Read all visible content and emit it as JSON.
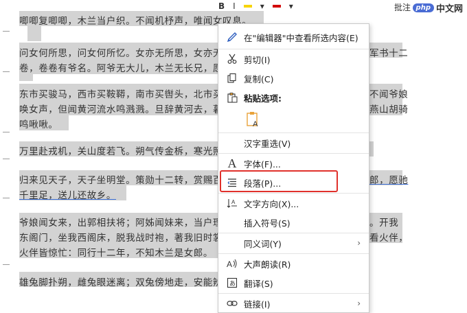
{
  "toolbar": {
    "comment_label": "批注"
  },
  "watermark": {
    "logo": "php",
    "text": "中文网"
  },
  "document": {
    "lines": [
      "唧唧复唧唧，木兰当户织。不闻机杼声，唯闻女叹息。",
      "问女何所思，问女何所忆。女亦无所思，女亦无",
      "卷，卷卷有爷名。阿爷无大儿，木兰无长兄，愿",
      "东市买骏马，西市买鞍鞯，南市买辔头，北市买",
      "唤女声，但闻黄河流水鸣溅溅。旦辞黄河去，暮",
      "鸣啾啾。",
      "万里赴戎机，关山度若飞。朔气传金柝，寒光照",
      "归来见天子，天子坐明堂。策勋十二转，赏赐百",
      "千里足，送儿还故乡。",
      "爷娘闻女来，出郭相扶将；阿姊闻妹来，当户理",
      "东阁门，坐我西阁床，脱我战时袍，著我旧时裳",
      "火伴皆惊忙：同行十二年，不知木兰是女郎。",
      "雄兔脚扑朔，雌兔眼迷离；双兔傍地走，安能辨"
    ],
    "right_fragments": [
      "军书十二",
      "不闻爷娘",
      "燕山胡骑",
      "郎，愿驰",
      "。开我",
      "看火伴，"
    ]
  },
  "context_menu": {
    "items": [
      {
        "label": "在\"编辑器\"中查看所选内容(E)",
        "icon": "pen-icon"
      },
      {
        "label": "剪切(I)",
        "icon": "scissors-icon"
      },
      {
        "label": "复制(C)",
        "icon": "copy-icon"
      },
      {
        "label": "粘贴选项:",
        "icon": "clipboard-icon"
      },
      {
        "label": "汉字重选(V)",
        "icon": ""
      },
      {
        "label": "字体(F)...",
        "icon": "font-icon"
      },
      {
        "label": "段落(P)...",
        "icon": "paragraph-icon"
      },
      {
        "label": "文字方向(X)...",
        "icon": "text-direction-icon"
      },
      {
        "label": "插入符号(S)",
        "icon": ""
      },
      {
        "label": "同义词(Y)",
        "icon": ""
      },
      {
        "label": "大声朗读(R)",
        "icon": "read-aloud-icon"
      },
      {
        "label": "翻译(S)",
        "icon": "translate-icon"
      },
      {
        "label": "链接(I)",
        "icon": "link-icon"
      }
    ]
  },
  "colors": {
    "highlight_box": "#e0302b",
    "selection": "#d3d3d3"
  }
}
